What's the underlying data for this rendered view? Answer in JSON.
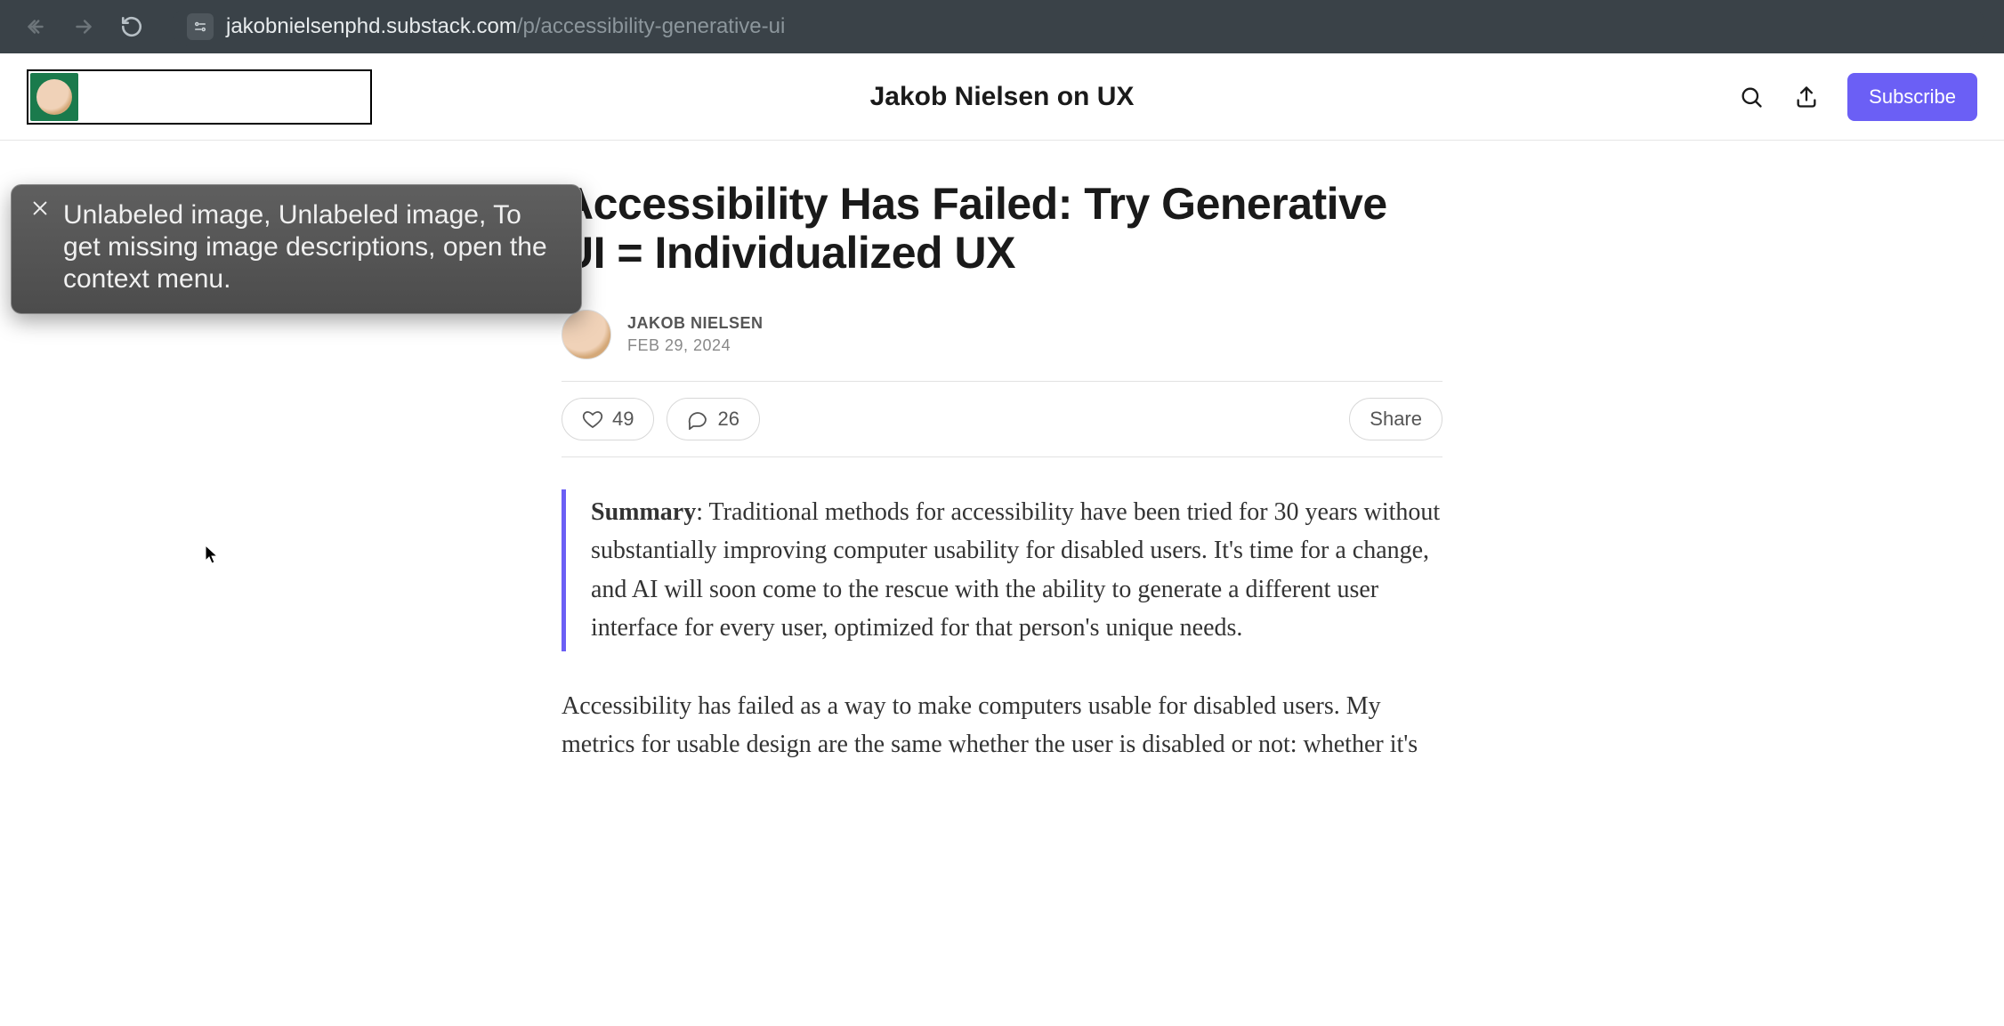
{
  "browser": {
    "url_main": "jakobnielsenphd.substack.com",
    "url_path": "/p/accessibility-generative-ui"
  },
  "header": {
    "site_title": "Jakob Nielsen on UX",
    "subscribe_label": "Subscribe"
  },
  "tooltip": {
    "text": "Unlabeled image, Unlabeled image, To get missing image descriptions, open the context menu."
  },
  "article": {
    "title": "Accessibility Has Failed: Try Generative UI = Individualized UX",
    "author_name": "JAKOB NIELSEN",
    "pub_date": "FEB 29, 2024",
    "likes": "49",
    "comments": "26",
    "share_label": "Share",
    "summary_label": "Summary",
    "summary_text": ": Traditional methods for accessibility have been tried for 30 years without substantially improving computer usability for disabled users. It's time for a change, and AI will soon come to the rescue with the ability to generate a different user interface for every user, optimized for that person's unique needs.",
    "body_para_1": "Accessibility has failed as a way to make computers usable for disabled users. My metrics for usable design are the same whether the user is disabled or not: whether it's"
  }
}
